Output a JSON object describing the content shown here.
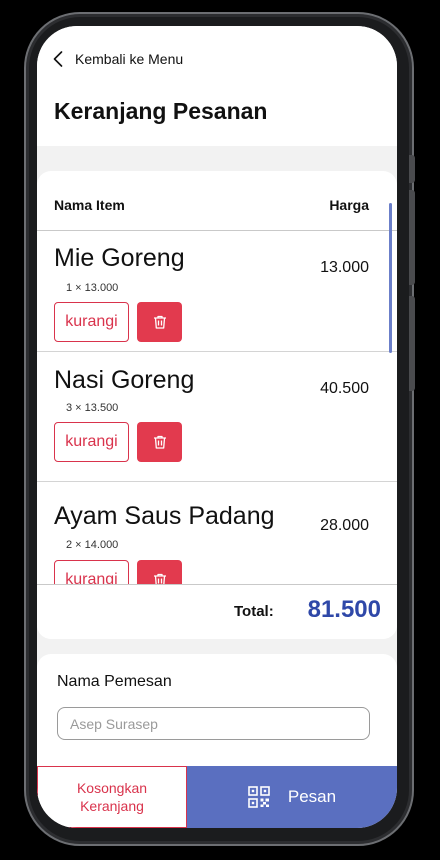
{
  "header": {
    "back_label": "Kembali ke Menu",
    "title": "Keranjang Pesanan"
  },
  "table": {
    "col_name": "Nama Item",
    "col_price": "Harga"
  },
  "items": [
    {
      "name": "Mie Goreng",
      "qty": "1 × 13.000",
      "price": "13.000",
      "reduce_label": "kurangi"
    },
    {
      "name": "Nasi Goreng",
      "qty": "3 × 13.500",
      "price": "40.500",
      "reduce_label": "kurangi"
    },
    {
      "name": "Ayam Saus Padang",
      "qty": "2 × 14.000",
      "price": "28.000",
      "reduce_label": "kurangi"
    }
  ],
  "summary": {
    "total_label": "Total:",
    "total_value": "81.500"
  },
  "customer": {
    "label": "Nama Pemesan",
    "placeholder": "Asep Surasep"
  },
  "footer": {
    "clear_line1": "Kosongkan",
    "clear_line2": "Keranjang",
    "order_label": "Pesan"
  },
  "icons": {
    "back": "chevron-left-icon",
    "delete": "trash-icon",
    "order": "qr-code-icon"
  },
  "colors": {
    "danger": "#e23a4e",
    "primary": "#5a6fc0",
    "total": "#2f48a8"
  }
}
